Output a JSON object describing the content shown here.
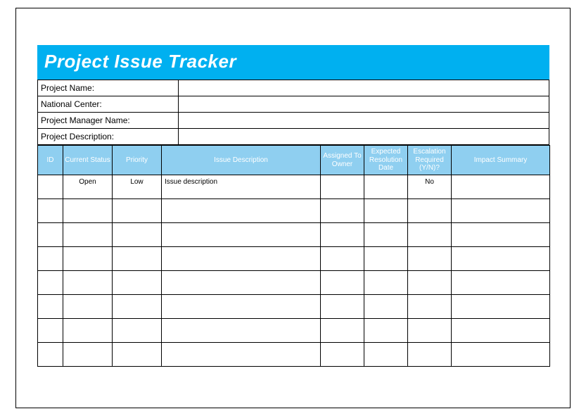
{
  "title": "Project Issue Tracker",
  "meta": {
    "project_name_label": "Project Name:",
    "project_name_value": "",
    "national_center_label": "National Center:",
    "national_center_value": "",
    "project_manager_label": "Project Manager Name:",
    "project_manager_value": "",
    "project_description_label": "Project Description:",
    "project_description_value": ""
  },
  "columns": {
    "id": "ID",
    "current_status": "Current Status",
    "priority": "Priority",
    "issue_description": "Issue Description",
    "assigned_to_owner": "Assigned To Owner",
    "expected_resolution_date": "Expected Resolution Date",
    "escalation_required": "Escalation Required (Y/N)?",
    "impact_summary": "Impact Summary"
  },
  "rows": [
    {
      "id": "",
      "current_status": "Open",
      "priority": "Low",
      "issue_description": "Issue description",
      "assigned_to_owner": "",
      "expected_resolution_date": "",
      "escalation_required": "No",
      "impact_summary": ""
    },
    {
      "id": "",
      "current_status": "",
      "priority": "",
      "issue_description": "",
      "assigned_to_owner": "",
      "expected_resolution_date": "",
      "escalation_required": "",
      "impact_summary": ""
    },
    {
      "id": "",
      "current_status": "",
      "priority": "",
      "issue_description": "",
      "assigned_to_owner": "",
      "expected_resolution_date": "",
      "escalation_required": "",
      "impact_summary": ""
    },
    {
      "id": "",
      "current_status": "",
      "priority": "",
      "issue_description": "",
      "assigned_to_owner": "",
      "expected_resolution_date": "",
      "escalation_required": "",
      "impact_summary": ""
    },
    {
      "id": "",
      "current_status": "",
      "priority": "",
      "issue_description": "",
      "assigned_to_owner": "",
      "expected_resolution_date": "",
      "escalation_required": "",
      "impact_summary": ""
    },
    {
      "id": "",
      "current_status": "",
      "priority": "",
      "issue_description": "",
      "assigned_to_owner": "",
      "expected_resolution_date": "",
      "escalation_required": "",
      "impact_summary": ""
    },
    {
      "id": "",
      "current_status": "",
      "priority": "",
      "issue_description": "",
      "assigned_to_owner": "",
      "expected_resolution_date": "",
      "escalation_required": "",
      "impact_summary": ""
    },
    {
      "id": "",
      "current_status": "",
      "priority": "",
      "issue_description": "",
      "assigned_to_owner": "",
      "expected_resolution_date": "",
      "escalation_required": "",
      "impact_summary": ""
    }
  ]
}
